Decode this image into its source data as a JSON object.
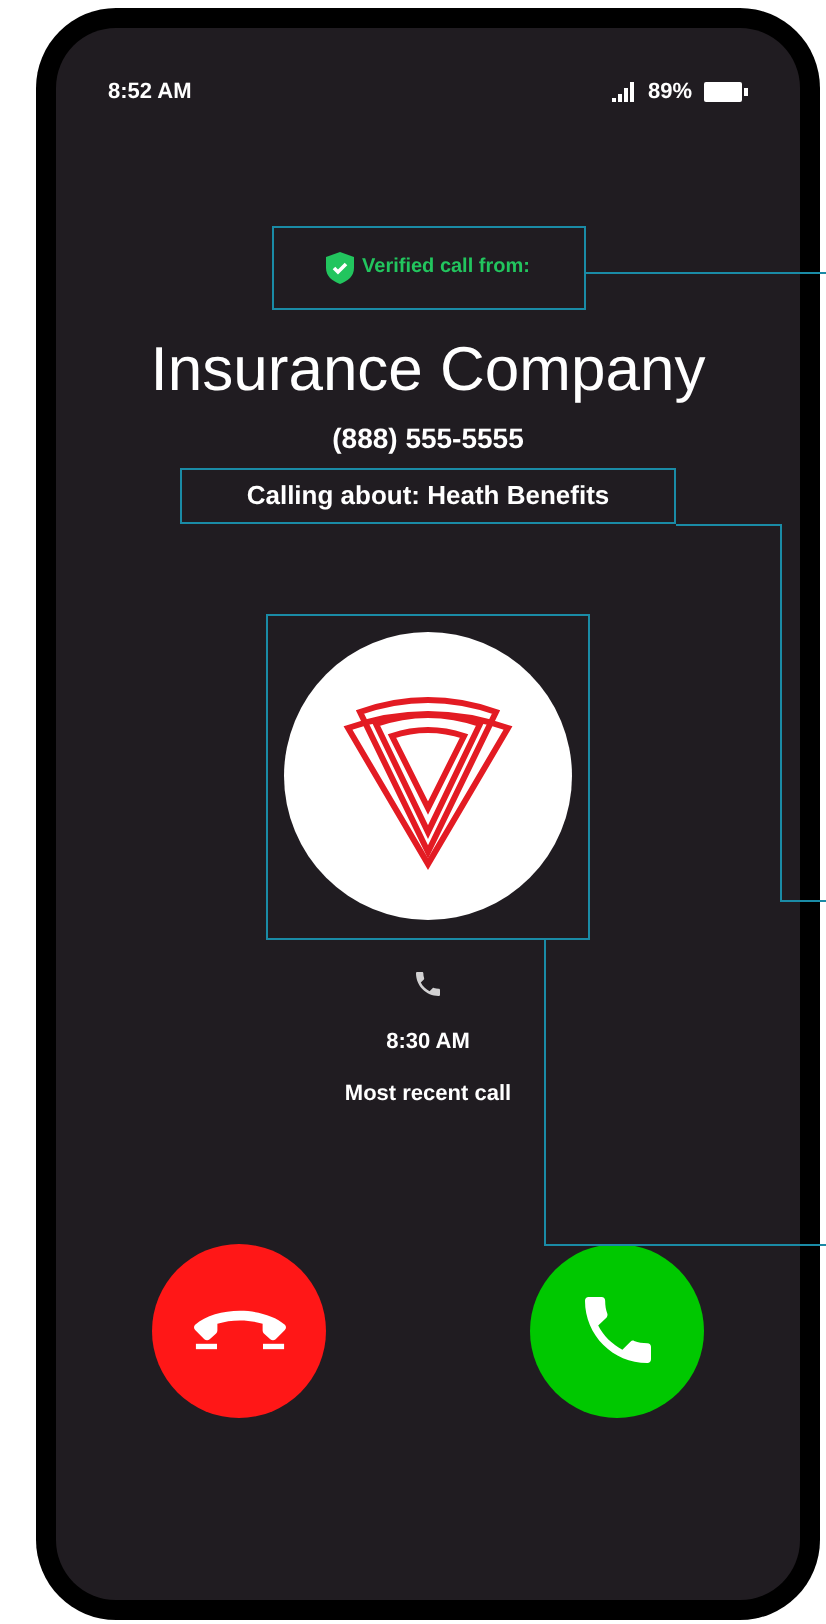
{
  "status_bar": {
    "time": "8:52 AM",
    "battery": "89%"
  },
  "caller": {
    "verified_label": "Verified call from:",
    "name": "Insurance Company",
    "number": "(888) 555-5555",
    "reason": "Calling about: Heath Benefits"
  },
  "recent_call": {
    "time": "8:30 AM",
    "label": "Most recent call"
  },
  "actions": [
    {
      "kind": "decline"
    },
    {
      "kind": "accept"
    }
  ]
}
